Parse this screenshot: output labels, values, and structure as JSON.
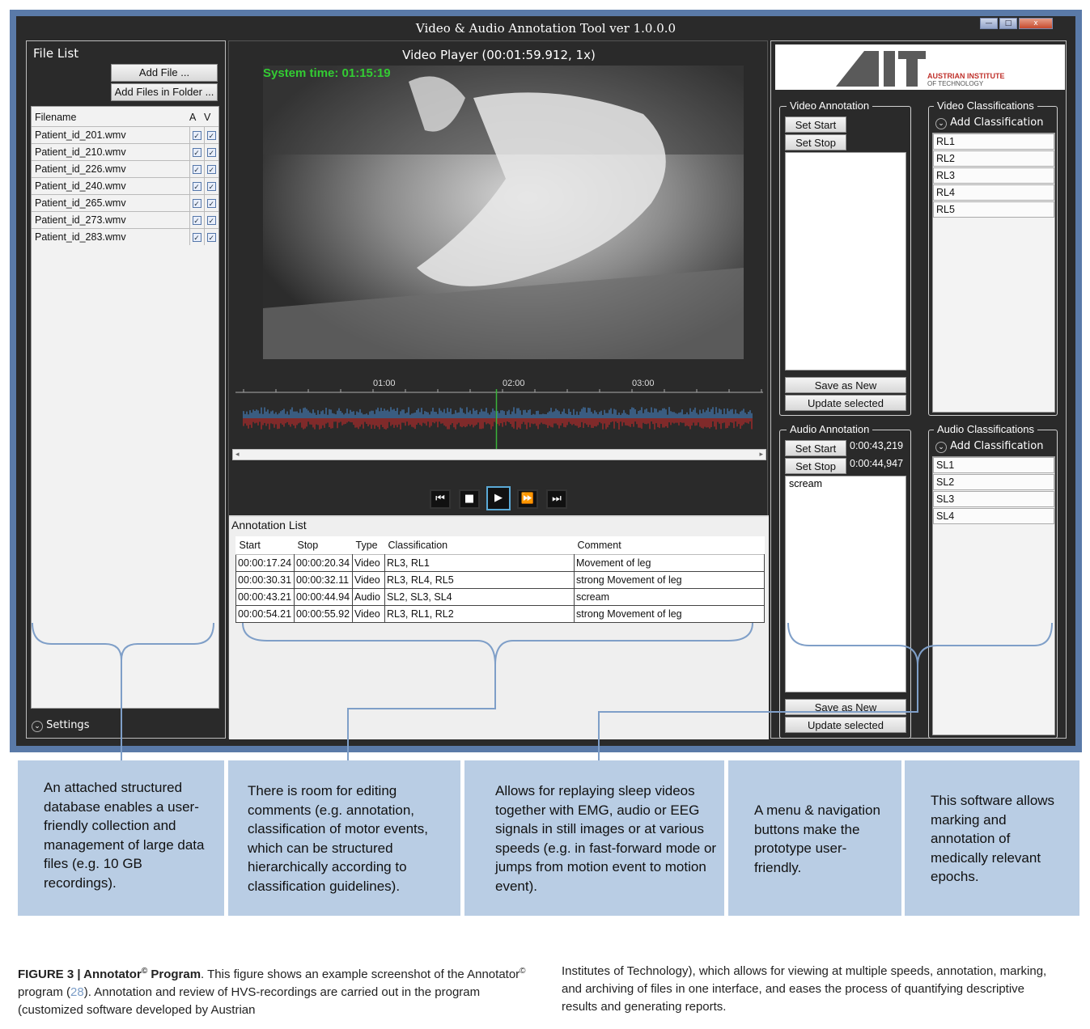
{
  "window": {
    "title": "Video & Audio Annotation Tool ver 1.0.0.0",
    "close_label": "x"
  },
  "file_list": {
    "title": "File List",
    "add_file": "Add File ...",
    "add_folder": "Add Files in Folder ...",
    "columns": [
      "Filename",
      "A",
      "V"
    ],
    "files": [
      "Patient_id_201.wmv",
      "Patient_id_210.wmv",
      "Patient_id_226.wmv",
      "Patient_id_240.wmv",
      "Patient_id_265.wmv",
      "Patient_id_273.wmv",
      "Patient_id_283.wmv"
    ],
    "settings": "Settings"
  },
  "player": {
    "title": "Video Player (00:01:59.912, 1x)",
    "system_time": "System time: 01:15:19",
    "ticks": [
      "01:00",
      "02:00",
      "03:00"
    ],
    "progress_fraction": 0.5
  },
  "annotation_list": {
    "title": "Annotation List",
    "columns": [
      "Start",
      "Stop",
      "Type",
      "Classification",
      "Comment"
    ],
    "rows": [
      [
        "00:00:17.24",
        "00:00:20.34",
        "Video",
        "RL3, RL1",
        "Movement of leg"
      ],
      [
        "00:00:30.31",
        "00:00:32.11",
        "Video",
        "RL3, RL4, RL5",
        "strong Movement of leg"
      ],
      [
        "00:00:43.21",
        "00:00:44.94",
        "Audio",
        "SL2, SL3, SL4",
        "scream"
      ],
      [
        "00:00:54.21",
        "00:00:55.92",
        "Video",
        "RL3, RL1, RL2",
        "strong Movement of leg"
      ]
    ]
  },
  "logo": {
    "mark": "AIT",
    "line1": "AUSTRIAN INSTITUTE",
    "line2": "OF TECHNOLOGY"
  },
  "video_annotation": {
    "title": "Video Annotation",
    "set_start": "Set Start",
    "set_stop": "Set Stop",
    "save_new": "Save as New",
    "update": "Update selected"
  },
  "video_classifications": {
    "title": "Video Classifications",
    "add": "Add Classification",
    "items": [
      "RL1",
      "RL2",
      "RL3",
      "RL4",
      "RL5"
    ]
  },
  "audio_annotation": {
    "title": "Audio Annotation",
    "set_start": "Set Start",
    "set_stop": "Set Stop",
    "start_time": "0:00:43,219",
    "stop_time": "0:00:44,947",
    "comment": "scream",
    "save_new": "Save as New",
    "update": "Update selected"
  },
  "audio_classifications": {
    "title": "Audio Classifications",
    "add": "Add Classification",
    "items": [
      "SL1",
      "SL2",
      "SL3",
      "SL4"
    ]
  },
  "callouts": [
    "An attached structured database enables a user-friendly collection and management of large data files (e.g. 10 GB recordings).",
    "There is room for editing comments (e.g. annotation, classification of motor events, which can be structured hierarchically according to classification guidelines).",
    "Allows for replaying sleep videos together with EMG, audio or EEG signals in still images or at various speeds (e.g. in fast-forward mode or jumps from motion event to motion event).",
    "A menu & navigation buttons make the prototype user-friendly.",
    "This software allows marking and annotation of medically relevant epochs."
  ],
  "figure": {
    "label": "FIGURE 3 | Annotator",
    "label_sup": "©",
    "label_end": " Program",
    "text_a": ". This figure shows an example screenshot of the Annotator",
    "text_a_sup": "©",
    "text_b": " program (",
    "ref": "28",
    "text_c": "). Annotation and review of HVS-recordings are carried out in the program (customized software developed by Austrian",
    "text_right": "Institutes of Technology), which allows for viewing at multiple speeds, annotation, marking, and archiving of files in one interface, and eases the process of quantifying descriptive results and generating reports."
  }
}
